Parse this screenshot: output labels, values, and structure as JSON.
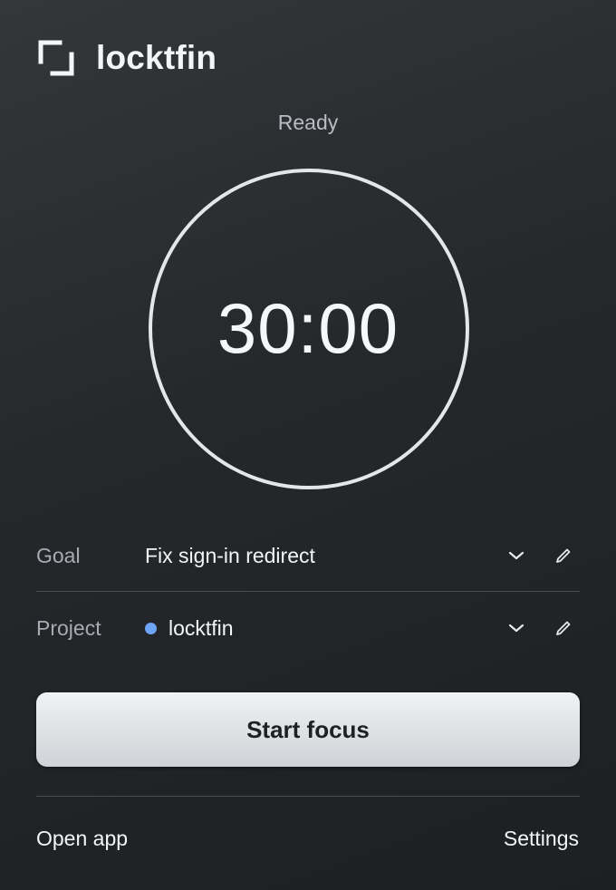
{
  "app": {
    "name": "locktfin",
    "logo_icon": "bracket-frame-icon"
  },
  "timer": {
    "status": "Ready",
    "value": "30:00"
  },
  "fields": {
    "goal": {
      "label": "Goal",
      "value": "Fix sign-in redirect",
      "dropdown_icon": "chevron-down-icon",
      "edit_icon": "pencil-icon"
    },
    "project": {
      "label": "Project",
      "value": "locktfin",
      "color": "#6ea5f7",
      "dropdown_icon": "chevron-down-icon",
      "edit_icon": "pencil-icon"
    }
  },
  "actions": {
    "start_label": "Start focus"
  },
  "footer": {
    "open_app_label": "Open app",
    "settings_label": "Settings"
  },
  "colors": {
    "background": "#25272b",
    "accent_dot": "#6ea5f7",
    "ring": "#e4e6ea"
  }
}
